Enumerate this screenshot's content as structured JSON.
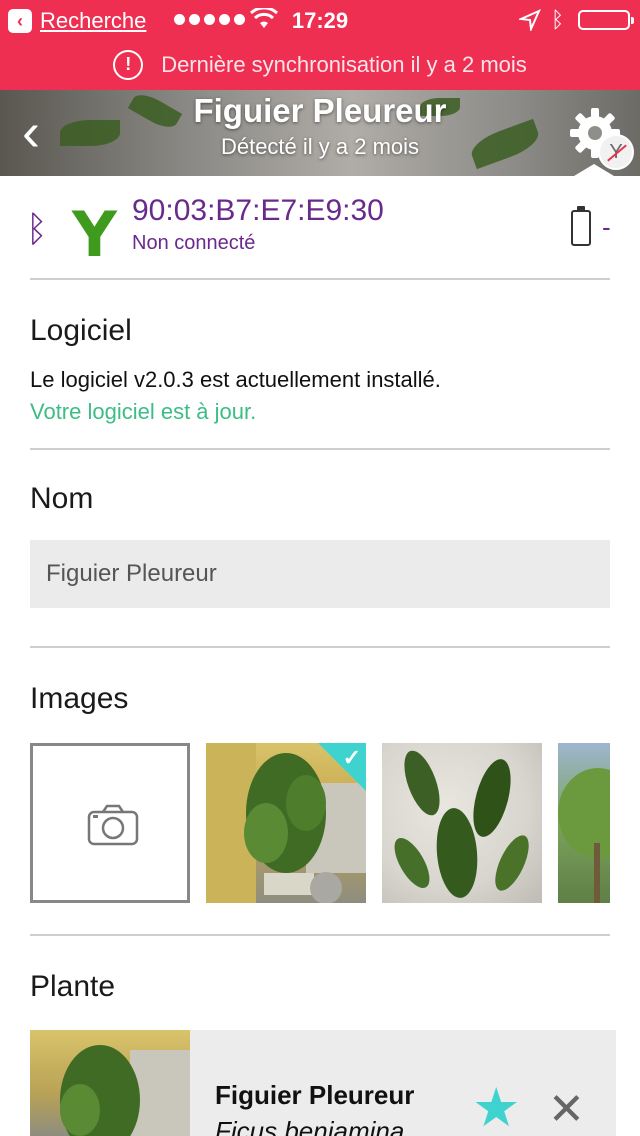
{
  "status_bar": {
    "back_app_label": "Recherche",
    "time": "17:29"
  },
  "sync_banner": {
    "message": "Dernière synchronisation il y a 2 mois"
  },
  "header": {
    "title": "Figuier Pleureur",
    "subtitle": "Détecté il y a 2 mois"
  },
  "device": {
    "mac_address": "90:03:B7:E7:E9:30",
    "connection_status": "Non connecté",
    "battery_value": "-"
  },
  "software": {
    "title": "Logiciel",
    "installed_text": "Le logiciel v2.0.3 est actuellement installé.",
    "status_text": "Votre logiciel est à jour."
  },
  "name_section": {
    "title": "Nom",
    "value": "Figuier Pleureur"
  },
  "images_section": {
    "title": "Images"
  },
  "plant_section": {
    "title": "Plante",
    "common_name": "Figuier Pleureur",
    "latin_name": "Ficus benjamina"
  },
  "colors": {
    "accent_red": "#ee2f52",
    "purple": "#6a2a8c",
    "green": "#3dbd86",
    "teal": "#3fd3d0"
  }
}
